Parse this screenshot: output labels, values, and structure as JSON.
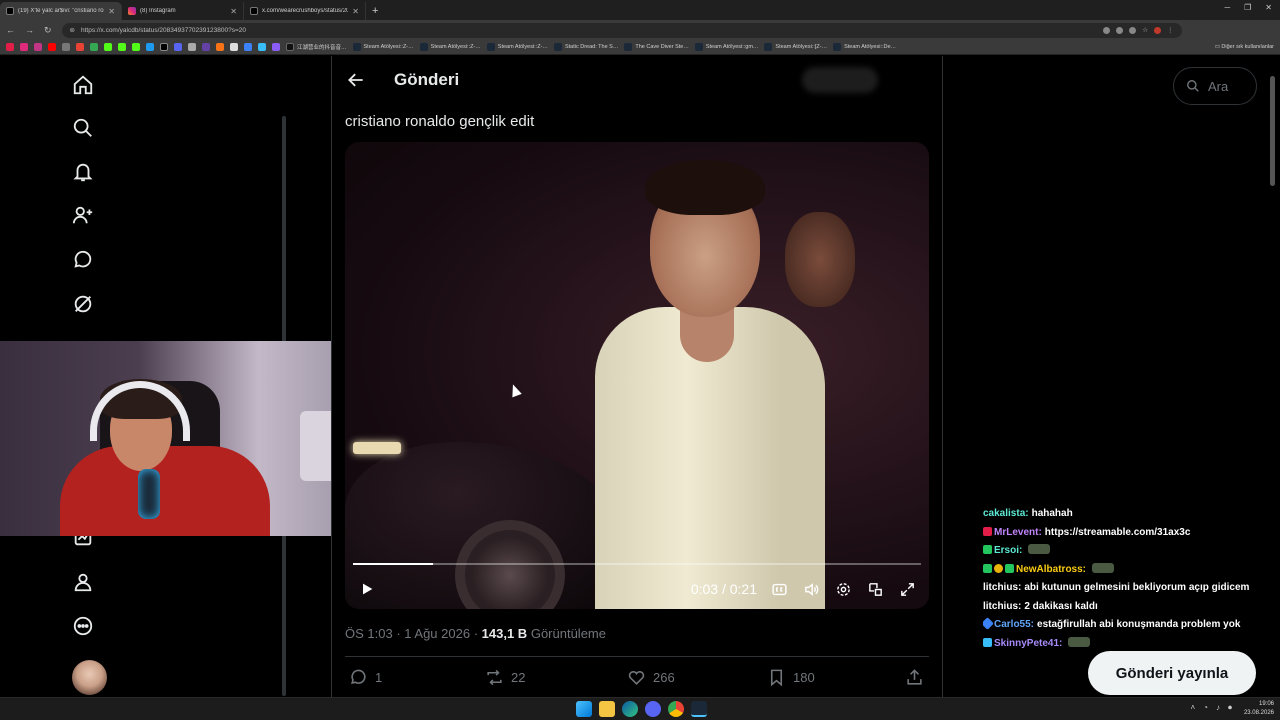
{
  "browser": {
    "tabs": [
      {
        "title": "(19) X'te yalc ar$ivi: \"cristiano ronal",
        "icon": "x-icon",
        "active": true
      },
      {
        "title": "(8) Instagram",
        "icon": "instagram-icon",
        "active": false
      },
      {
        "title": "x.com/wearecrushboys/status/20",
        "icon": "x-icon",
        "active": false
      }
    ],
    "url": "https://x.com/yalcdb/status/2083493770239123800?s=20",
    "bookmarks": [
      "江湖营业的抖音音…",
      "Steam Atölyesi::Z-…",
      "Steam Atölyesi::Z-…",
      "Steam Atölyesi::Z-…",
      "Static Dread: The S…",
      "The Cave Diver Ste…",
      "Steam Atölyesi::gm…",
      "Steam Atölyesi::[Z-…",
      "Steam Atölyesi::De…"
    ],
    "other_bookmarks": "Diğer sık kullanılanlar"
  },
  "post": {
    "header_title": "Gönderi",
    "text": "cristiano ronaldo gençlik edit",
    "video": {
      "current_time": "0:03",
      "duration": "0:21",
      "time_display": "0:03 / 0:21",
      "progress": 0.14
    },
    "meta": {
      "time": "ÖS 1:03",
      "date": "1 Ağu 2026",
      "views": "143,1 B",
      "views_label": "Görüntüleme"
    },
    "actions": {
      "replies": "1",
      "reposts": "22",
      "likes": "266",
      "bookmarks": "180"
    }
  },
  "search": {
    "placeholder": "Ara"
  },
  "compose": {
    "label": "Gönderi yayınla"
  },
  "chat": [
    {
      "name": "cakalista:",
      "color": "#5eead4",
      "msg": "hahahah",
      "badges": []
    },
    {
      "name": "MrLevent:",
      "color": "#c084fc",
      "msg": "https://streamable.com/31ax3c",
      "badges": [
        "#e11d48"
      ]
    },
    {
      "name": "Ersoi:",
      "color": "#5eead4",
      "msg": "",
      "badges": [
        "#22c55e"
      ],
      "emote": true
    },
    {
      "name": "NewAlbatross:",
      "color": "#facc15",
      "msg": "",
      "badges": [
        "#22c55e",
        "#eab308",
        "#22c55e"
      ],
      "emote": true
    },
    {
      "name": "litchius:",
      "color": "#ffffff",
      "msg": "abi kutunun gelmesini bekliyorum açıp gidicem",
      "badges": []
    },
    {
      "name": "litchius:",
      "color": "#ffffff",
      "msg": "2 dakikası kaldı",
      "badges": []
    },
    {
      "name": "Carlo55:",
      "color": "#60a5fa",
      "msg": "estağfirullah abi konuşmanda problem yok",
      "badges": [
        "#3b82f6"
      ]
    },
    {
      "name": "SkinnyPete41:",
      "color": "#a78bfa",
      "msg": "",
      "badges": [
        "#38bdf8"
      ],
      "emote": true
    }
  ],
  "taskbar": {
    "clock_time": "19:06",
    "clock_date": "23.08.2026"
  },
  "colors": {
    "background": "#000000",
    "text": "#e7e9ea",
    "muted": "#71767b",
    "border": "#2f3336"
  }
}
